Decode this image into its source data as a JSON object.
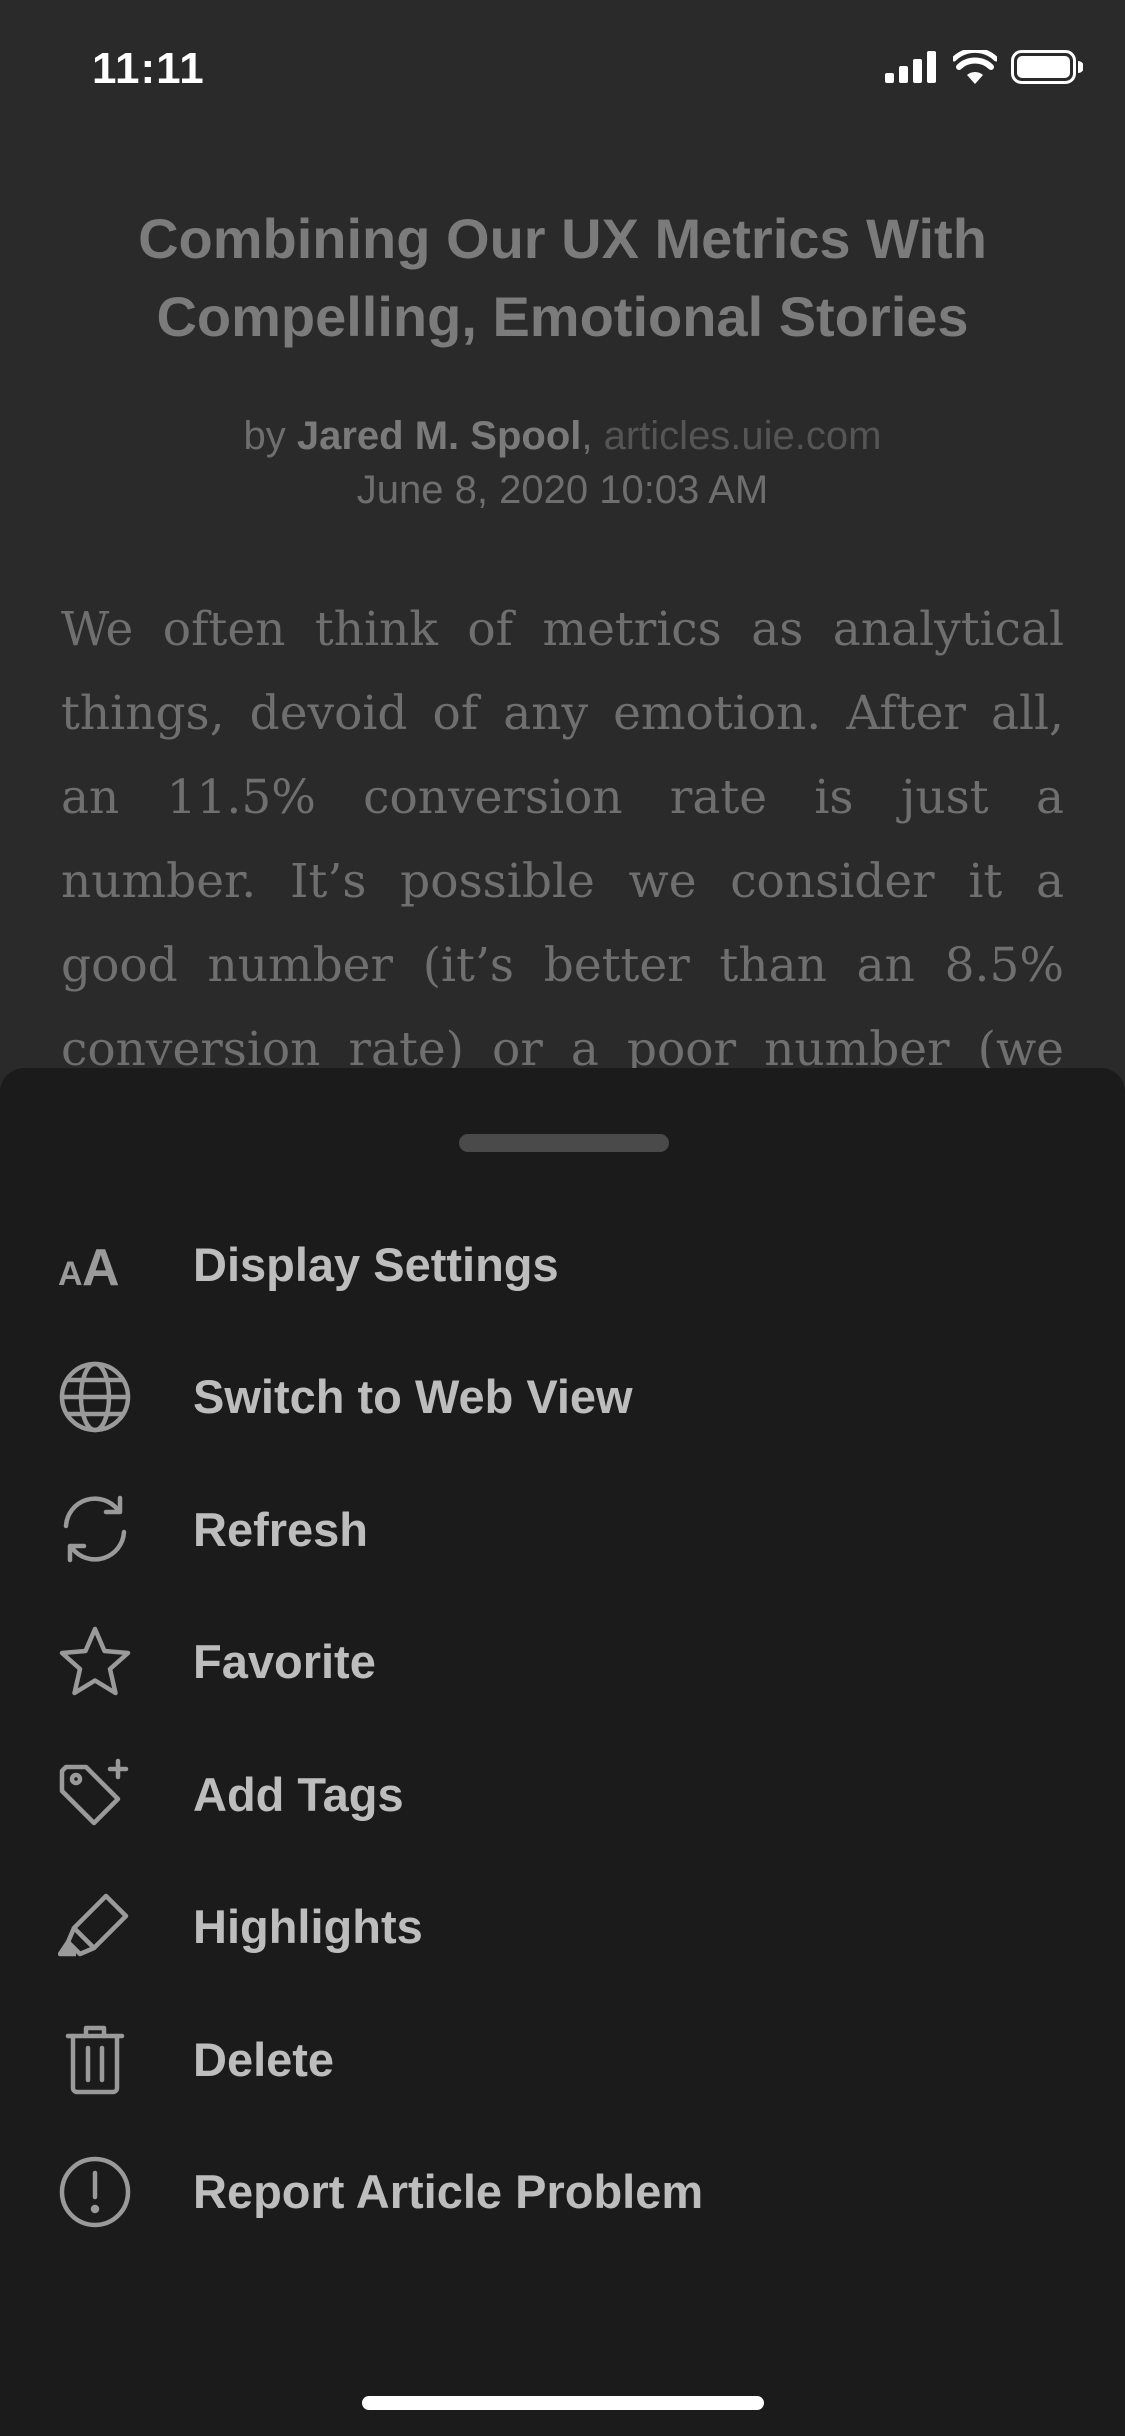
{
  "status_bar": {
    "time": "11:11",
    "icons": [
      "signal-icon",
      "wifi-icon",
      "battery-icon"
    ]
  },
  "article": {
    "title": "Combining Our UX Metrics With Compelling, Emotional Stories",
    "byline_prefix": "by ",
    "author": "Jared M. Spool",
    "separator": ", ",
    "source": "articles.uie.com",
    "date": "June 8, 2020 10:03 AM",
    "body": "We often think of metrics as analytical things, devoid of any emotion. After all, an 11.5% conversion rate is just a number. It’s possible we consider it a good number (it’s better than an 8.5% conversion rate) or a poor number (we really wanted a"
  },
  "menu": {
    "items": [
      {
        "label": "Display Settings",
        "icon": "text-size-icon"
      },
      {
        "label": "Switch to Web View",
        "icon": "globe-icon"
      },
      {
        "label": "Refresh",
        "icon": "refresh-icon"
      },
      {
        "label": "Favorite",
        "icon": "star-icon"
      },
      {
        "label": "Add Tags",
        "icon": "tag-add-icon"
      },
      {
        "label": "Highlights",
        "icon": "highlighter-icon"
      },
      {
        "label": "Delete",
        "icon": "trash-icon"
      },
      {
        "label": "Report Article Problem",
        "icon": "alert-circle-icon"
      }
    ]
  },
  "colors": {
    "background": "#2a2a2a",
    "sheet": "#1b1b1b",
    "menu_text": "#bdbdbd",
    "icon": "#9a9a9a"
  }
}
